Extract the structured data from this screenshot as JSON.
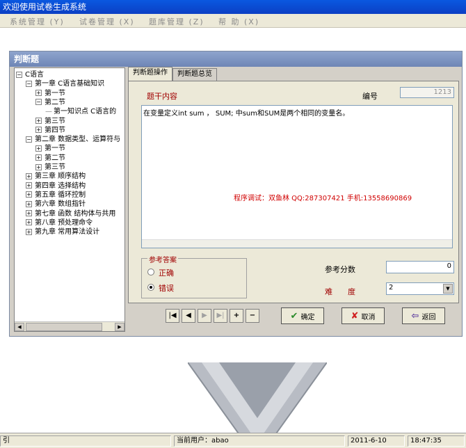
{
  "window": {
    "title": "欢迎使用试卷生成系统"
  },
  "menu": [
    {
      "label": "系统管理",
      "key": "(Y)"
    },
    {
      "label": "试卷管理",
      "key": "(X)"
    },
    {
      "label": "题库管理",
      "key": "(Z)"
    },
    {
      "label": "帮 助",
      "key": "(X)"
    }
  ],
  "dialog": {
    "title": "判断题",
    "tree": [
      {
        "label": "C语言",
        "expander": "−",
        "level": 0
      },
      {
        "label": "第一章 C语言基础知识",
        "expander": "−",
        "level": 1
      },
      {
        "label": "第一节",
        "expander": "+",
        "level": 2
      },
      {
        "label": "第二节",
        "expander": "−",
        "level": 2
      },
      {
        "label": "第一知识点 C语言的",
        "expander": "",
        "level": 3
      },
      {
        "label": "第三节",
        "expander": "+",
        "level": 2
      },
      {
        "label": "第四节",
        "expander": "+",
        "level": 2
      },
      {
        "label": "第二章 数据类型、运算符与",
        "expander": "−",
        "level": 1
      },
      {
        "label": "第一节",
        "expander": "+",
        "level": 2
      },
      {
        "label": "第二节",
        "expander": "+",
        "level": 2
      },
      {
        "label": "第三节",
        "expander": "+",
        "level": 2
      },
      {
        "label": "第三章 顺序结构",
        "expander": "+",
        "level": 1
      },
      {
        "label": "第四章 选择结构",
        "expander": "+",
        "level": 1
      },
      {
        "label": "第五章 循环控制",
        "expander": "+",
        "level": 1
      },
      {
        "label": "第六章 数组指针",
        "expander": "+",
        "level": 1
      },
      {
        "label": "第七章 函数 结构体与共用",
        "expander": "+",
        "level": 1
      },
      {
        "label": "第八章 预处理命令",
        "expander": "+",
        "level": 1
      },
      {
        "label": "第九章 常用算法设计",
        "expander": "+",
        "level": 1
      }
    ],
    "tabs": [
      {
        "label": "判断题操作",
        "active": true
      },
      {
        "label": "判断题总览",
        "active": false
      }
    ],
    "stem_label": "题干内容",
    "number_label": "编号",
    "number_value": "1213",
    "question_text": "在变量定义int sum ， SUM; 中sum和SUM是两个相同的变量名。",
    "credit_text": "程序调试：双鱼林 QQ:287307421 手机:13558690869",
    "answer_group": {
      "title": "参考答案",
      "options": [
        "正确",
        "错误"
      ],
      "selected": "错误"
    },
    "score_label": "参考分数",
    "score_value": "0",
    "difficulty_label": "难　　度",
    "difficulty_value": "2",
    "buttons": {
      "ok": "确定",
      "cancel": "取消",
      "back": "返回"
    },
    "nav": [
      "|◀",
      "◀",
      "▶",
      "▶|",
      "+",
      "−"
    ]
  },
  "status": {
    "left": "引",
    "user": "当前用户：abao",
    "date": "2011-6-10",
    "time": "18:47:35"
  }
}
